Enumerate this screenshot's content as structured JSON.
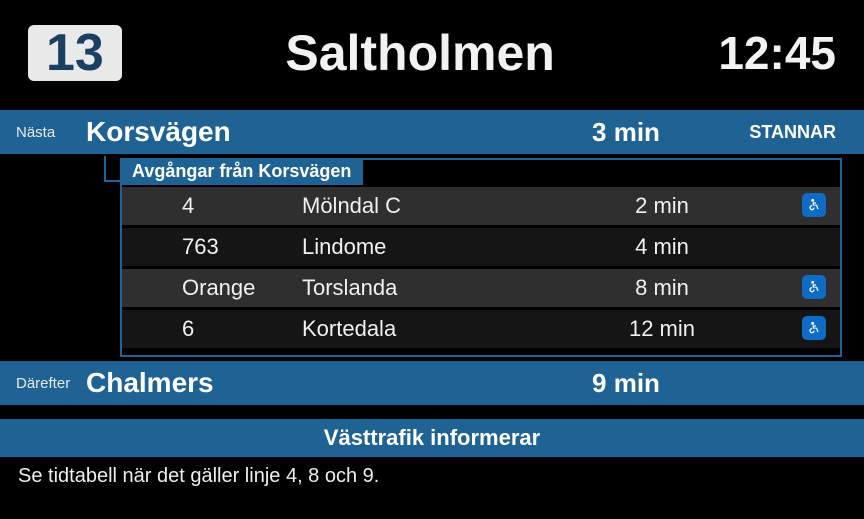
{
  "header": {
    "line": "13",
    "destination": "Saltholmen",
    "clock": "12:45"
  },
  "next": {
    "label": "Nästa",
    "name": "Korsvägen",
    "time": "3 min",
    "status": "STANNAR"
  },
  "dep_heading": "Avgångar från Korsvägen",
  "departures": [
    {
      "line": "4",
      "dest": "Mölndal C",
      "time": "2 min",
      "wheelchair": true
    },
    {
      "line": "763",
      "dest": "Lindome",
      "time": "4 min",
      "wheelchair": false
    },
    {
      "line": "Orange",
      "dest": "Torslanda",
      "time": "8 min",
      "wheelchair": true
    },
    {
      "line": "6",
      "dest": "Kortedala",
      "time": "12 min",
      "wheelchair": true
    }
  ],
  "after": {
    "label": "Därefter",
    "name": "Chalmers",
    "time": "9 min",
    "status": ""
  },
  "info": {
    "heading": "Västtrafik informerar",
    "body": "Se tidtabell när det gäller linje 4, 8 och 9."
  }
}
